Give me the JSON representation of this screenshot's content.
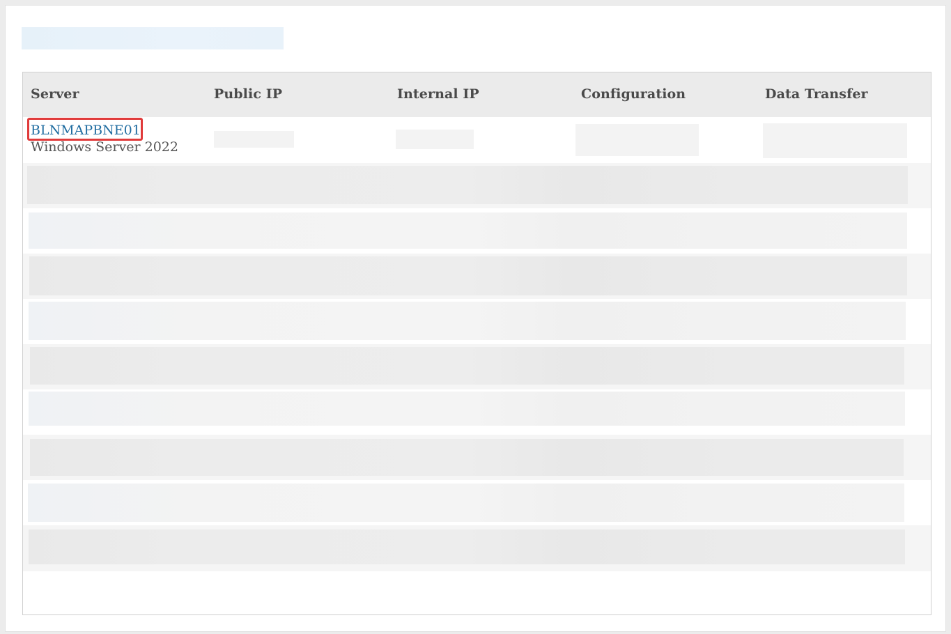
{
  "table": {
    "columns": [
      "Server",
      "Public IP",
      "Internal IP",
      "Configuration",
      "Data Transfer"
    ],
    "rows": [
      {
        "server_name": "BLNMAPBNE01",
        "server_os": "Windows Server 2022"
      }
    ]
  },
  "colors": {
    "link": "#1f6ca0",
    "highlight_border": "#e03a3a",
    "header_bg": "#ebebeb"
  }
}
